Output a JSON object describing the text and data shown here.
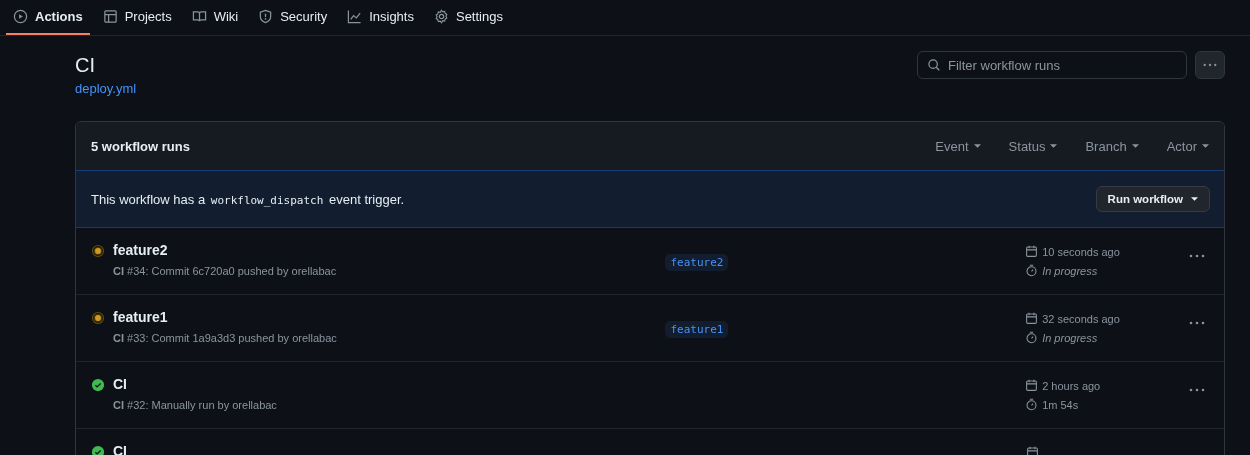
{
  "tabs": [
    {
      "label": "Actions",
      "selected": true
    },
    {
      "label": "Projects",
      "selected": false
    },
    {
      "label": "Wiki",
      "selected": false
    },
    {
      "label": "Security",
      "selected": false
    },
    {
      "label": "Insights",
      "selected": false
    },
    {
      "label": "Settings",
      "selected": false
    }
  ],
  "workflow": {
    "title": "CI",
    "file": "deploy.yml"
  },
  "search": {
    "placeholder": "Filter workflow runs"
  },
  "runs_box": {
    "count": "5 workflow runs",
    "filters": [
      "Event",
      "Status",
      "Branch",
      "Actor"
    ],
    "notice": {
      "before": "This workflow has a",
      "code": "workflow_dispatch",
      "after": "event trigger."
    },
    "run_button": "Run workflow"
  },
  "runs": [
    {
      "title": "feature2",
      "kind": "in_progress",
      "meta_bold": "CI",
      "meta": "#34: Commit 6c720a0 pushed by orellabac",
      "branch": "feature2",
      "time": "10 seconds ago",
      "duration": "In progress"
    },
    {
      "title": "feature1",
      "kind": "in_progress",
      "meta_bold": "CI",
      "meta": "#33: Commit 1a9a3d3 pushed by orellabac",
      "branch": "feature1",
      "time": "32 seconds ago",
      "duration": "In progress"
    },
    {
      "title": "CI",
      "kind": "success",
      "meta_bold": "CI",
      "meta": "#32: Manually run by orellabac",
      "time": "2 hours ago",
      "duration": "1m 54s"
    },
    {
      "title": "CI",
      "kind": "success"
    }
  ]
}
